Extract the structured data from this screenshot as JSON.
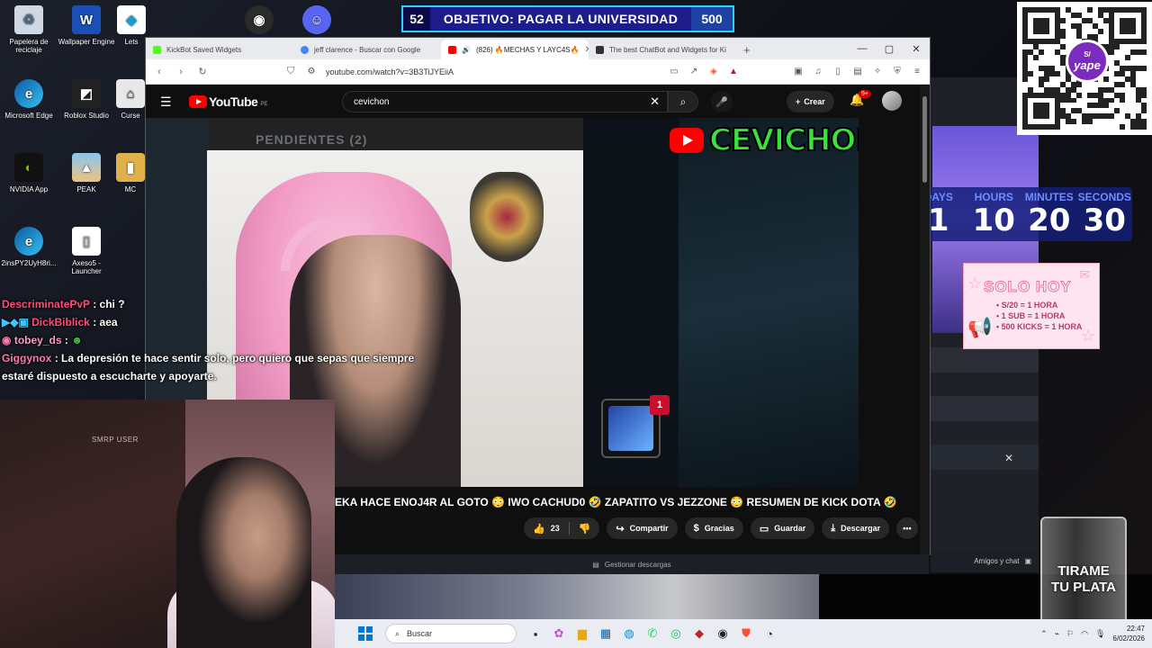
{
  "desktop": {
    "icons": [
      {
        "label": "Papelera de reciclaje"
      },
      {
        "label": "Wallpaper Engine"
      },
      {
        "label": "Lets"
      },
      {
        "label": "Microsoft Edge"
      },
      {
        "label": "Roblox Studio"
      },
      {
        "label": "Curse"
      },
      {
        "label": "NVIDIA App"
      },
      {
        "label": "PEAK"
      },
      {
        "label": "MC"
      },
      {
        "label": "2insPY2UyH8ri..."
      },
      {
        "label": "Axeso5 - Launcher"
      }
    ]
  },
  "overlay": {
    "goal": {
      "count": "52",
      "text": "OBJETIVO: PAGAR LA UNIVERSIDAD",
      "amount": "500"
    },
    "yape": {
      "currency": "S/",
      "brand": "yape"
    },
    "countdown": [
      {
        "label": "DAYS",
        "value": "1"
      },
      {
        "label": "HOURS",
        "value": "10"
      },
      {
        "label": "MINUTES",
        "value": "20"
      },
      {
        "label": "SECONDS",
        "value": "30"
      }
    ],
    "solo_hoy": {
      "title": "SOLO HOY",
      "items": [
        "S/20 = 1 HORA",
        "1 SUB = 1 HORA",
        "500 KICKS = 1 HORA"
      ]
    },
    "glass_text_line1": "TIRAME",
    "glass_text_line2": "TU PLATA",
    "webcam_label": "SMRP USER"
  },
  "chat": [
    {
      "user": "DescriminatePvP",
      "message": ": chi ?"
    },
    {
      "user": "DickBiblick",
      "message": ": aea"
    },
    {
      "user": "tobey_ds",
      "message": ":"
    },
    {
      "user": "Giggynox",
      "message": ": La depresión te hace sentir solo, pero quiero que sepas que siempre estaré dispuesto a escucharte y apoyarte."
    }
  ],
  "browser": {
    "tabs": [
      {
        "title": "KickBot Saved Widgets",
        "active": false
      },
      {
        "title": "jeff clarence - Buscar con Google",
        "active": false
      },
      {
        "title": "(826) 🔥MECHAS Y LAYC4S🔥",
        "active": true
      },
      {
        "title": "The best ChatBot and Widgets for Ki",
        "active": false
      }
    ],
    "url": "youtube.com/watch?v=3B3TiJYEiiA"
  },
  "youtube": {
    "logo_text": "YouTube",
    "country": "PE",
    "search_value": "cevichon",
    "create_label": "Crear",
    "notif_count": "9+",
    "video": {
      "pendientes": "PENDIENTES (2)",
      "channel_overlay": "CEVICHON",
      "notif_card_count": "1"
    },
    "title": "EKA HACE ENOJ4R AL GOTO 😳 IWO CACHUD0 🤣 ZAPATITO VS JEZZONE 😳 RESUMEN DE KICK DOTA 🤣",
    "actions": {
      "likes": "23",
      "share": "Compartir",
      "thanks": "Gracias",
      "save": "Guardar",
      "download": "Descargar"
    }
  },
  "below": {
    "downloads": "Gestionar descargas",
    "friends_chat": "Amigos y chat"
  },
  "taskbar": {
    "search_placeholder": "Buscar",
    "time": "22:47",
    "date": "6/02/2026"
  }
}
